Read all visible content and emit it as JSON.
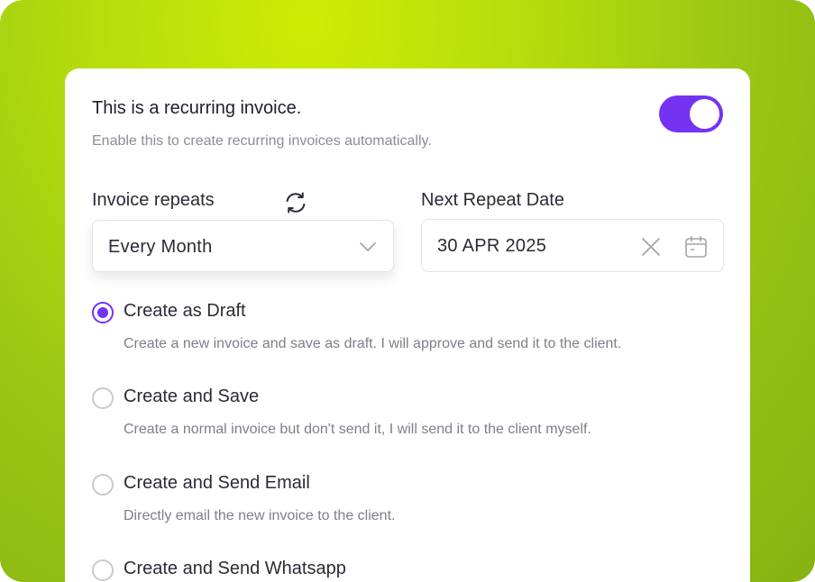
{
  "recurring": {
    "title": "This is a recurring invoice.",
    "subtitle": "Enable this to create recurring invoices automatically.",
    "enabled": true
  },
  "repeat": {
    "label": "Invoice repeats",
    "value": "Every Month"
  },
  "next_date": {
    "label": "Next Repeat Date",
    "value": "30 APR 2025"
  },
  "options": [
    {
      "label": "Create as Draft",
      "description": "Create a new invoice and save as draft. I will approve and send it to the client.",
      "selected": true
    },
    {
      "label": "Create and Save",
      "description": "Create a normal invoice but don't send it, I will send it to the client myself.",
      "selected": false
    },
    {
      "label": "Create and Send Email",
      "description": "Directly email the new invoice to the client.",
      "selected": false
    },
    {
      "label": "Create and Send Whatsapp",
      "description": "",
      "selected": false
    }
  ],
  "colors": {
    "accent": "#7433f2",
    "background": "#b6dd0c"
  },
  "icons": {
    "sync": "sync-icon",
    "chevron": "chevron-down-icon",
    "clear": "close-icon",
    "calendar": "calendar-icon"
  }
}
